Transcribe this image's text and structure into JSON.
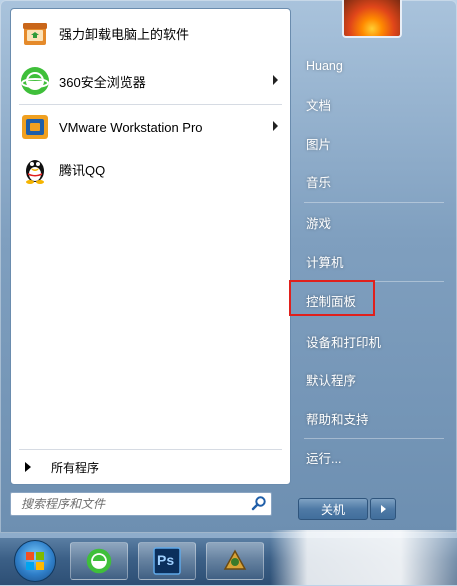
{
  "start_menu": {
    "pinned_items": [
      {
        "label": "强力卸载电脑上的软件",
        "icon": "uninstaller-icon",
        "has_submenu": false
      },
      {
        "label": "360安全浏览器",
        "icon": "360-browser-icon",
        "has_submenu": true
      },
      {
        "label": "VMware Workstation Pro",
        "icon": "vmware-icon",
        "has_submenu": true
      },
      {
        "label": "腾讯QQ",
        "icon": "qq-penguin-icon",
        "has_submenu": false
      }
    ],
    "all_programs_label": "所有程序",
    "search": {
      "placeholder": "搜索程序和文件",
      "icon": "search-magnifier-icon"
    },
    "right_items": [
      {
        "label": "Huang"
      },
      {
        "label": "文档"
      },
      {
        "label": "图片"
      },
      {
        "label": "音乐"
      },
      {
        "label": "游戏"
      },
      {
        "label": "计算机"
      },
      {
        "label": "控制面板",
        "highlighted": true
      },
      {
        "label": "设备和打印机"
      },
      {
        "label": "默认程序"
      },
      {
        "label": "帮助和支持"
      },
      {
        "label": "运行..."
      }
    ],
    "shutdown_label": "关机"
  },
  "taskbar": {
    "items": [
      {
        "icon": "windows-start-orb-icon"
      },
      {
        "icon": "360-browser-icon"
      },
      {
        "icon": "photoshop-icon",
        "text": "Ps"
      },
      {
        "icon": "fx-app-icon"
      }
    ]
  },
  "colors": {
    "highlight_box": "#e0201c",
    "menu_glass": "#7f9fbf"
  }
}
